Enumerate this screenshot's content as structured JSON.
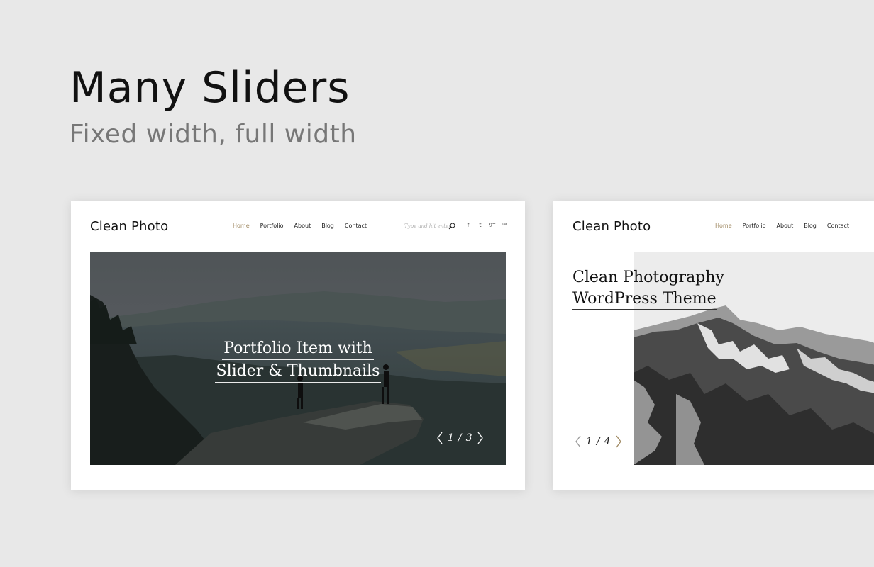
{
  "headline": "Many Sliders",
  "subheadline": "Fixed width, full width",
  "card1": {
    "logo": "Clean Photo",
    "nav": [
      "Home",
      "Portfolio",
      "About",
      "Blog",
      "Contact"
    ],
    "search_placeholder": "Type and hit enter",
    "social": [
      "f",
      "t",
      "g+",
      "rss"
    ],
    "caption_line1": "Portfolio Item with",
    "caption_line2": "Slider & Thumbnails",
    "pager": {
      "current": "1",
      "separator": "/",
      "total": "3"
    }
  },
  "card2": {
    "logo": "Clean Photo",
    "nav": [
      "Home",
      "Portfolio",
      "About",
      "Blog",
      "Contact"
    ],
    "caption_line1": "Clean Photography",
    "caption_line2": "WordPress Theme",
    "pager": {
      "current": "1",
      "separator": "/",
      "total": "4"
    }
  },
  "colors": {
    "accent": "#a08a63",
    "page_bg": "#e8e8e8"
  }
}
